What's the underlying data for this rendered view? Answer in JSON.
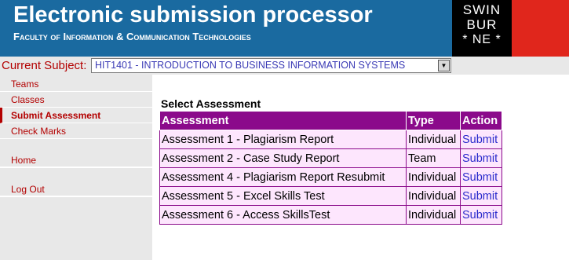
{
  "header": {
    "title": "Electronic submission processor",
    "faculty": "Faculty of Information & Communication Technologies",
    "logo_lines": [
      "SWIN",
      "BUR",
      "* NE *"
    ],
    "colors": {
      "header_bg": "#1a6aa0",
      "logo_bg": "#000000",
      "logo_red": "#e0261c"
    }
  },
  "subject": {
    "label": "Current Subject:",
    "selected": "HIT1401 - INTRODUCTION TO BUSINESS INFORMATION SYSTEMS"
  },
  "sidebar": {
    "items": [
      {
        "label": "Teams"
      },
      {
        "label": "Classes"
      },
      {
        "label": "Submit Assessment",
        "active": true
      },
      {
        "label": "Check Marks"
      },
      {
        "label": "Home"
      },
      {
        "label": "Log Out"
      }
    ]
  },
  "main": {
    "title": "Select Assessment",
    "columns": [
      "Assessment",
      "Type",
      "Action"
    ],
    "rows": [
      {
        "assessment": "Assessment 1 - Plagiarism Report",
        "type": "Individual",
        "action": "Submit"
      },
      {
        "assessment": "Assessment 2 - Case Study Report",
        "type": "Team",
        "action": "Submit"
      },
      {
        "assessment": "Assessment 4 - Plagiarism Report Resubmit",
        "type": "Individual",
        "action": "Submit"
      },
      {
        "assessment": "Assessment 5 - Excel Skills Test",
        "type": "Individual",
        "action": "Submit"
      },
      {
        "assessment": "Assessment 6 - Access SkillsTest",
        "type": "Individual",
        "action": "Submit"
      }
    ]
  }
}
